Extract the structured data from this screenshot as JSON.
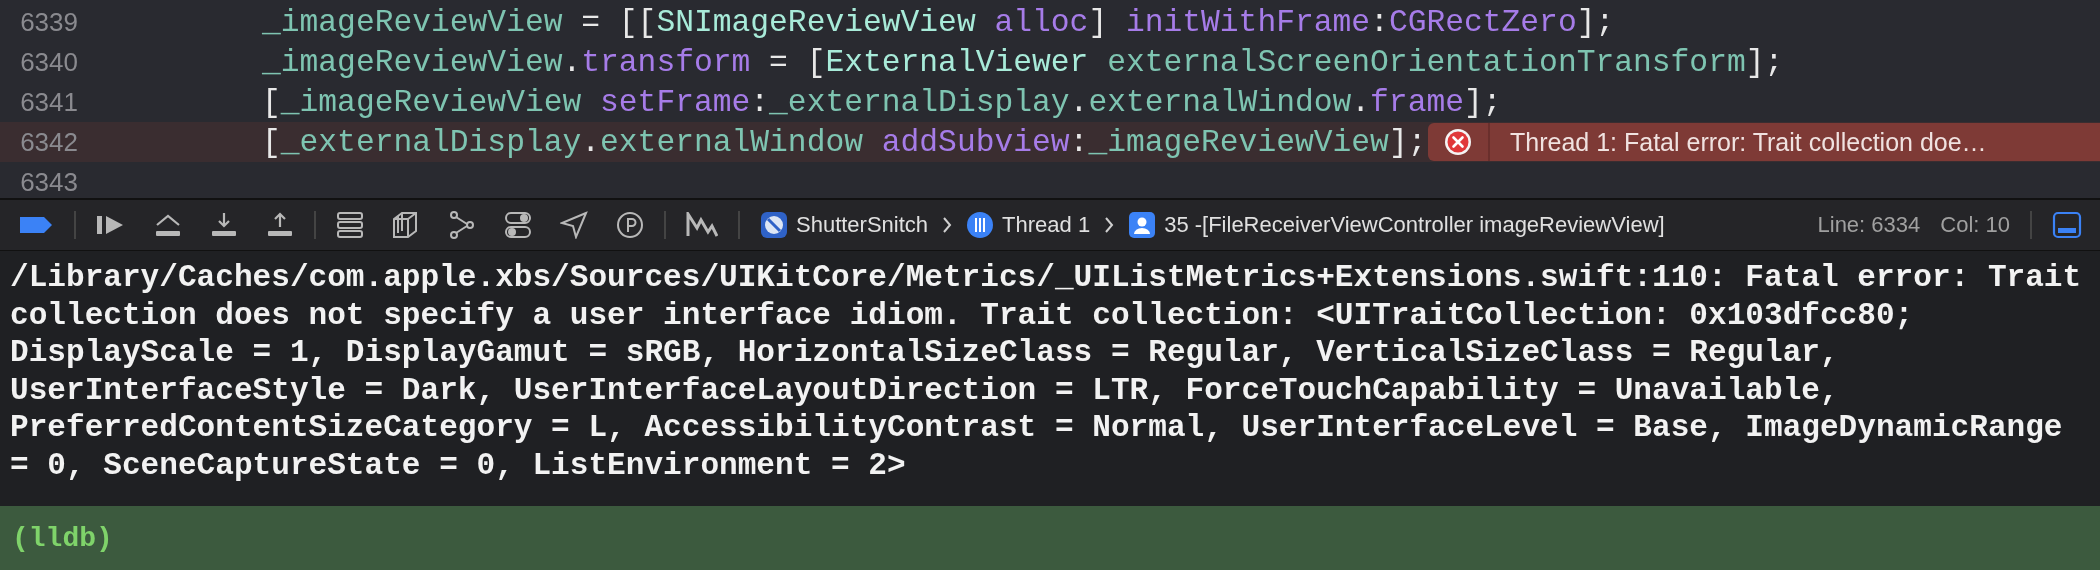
{
  "editor": {
    "lines": [
      {
        "number": "6339",
        "current": false,
        "tokens": [
          {
            "kind": "var",
            "text": "_imageReviewView"
          },
          {
            "kind": "plain",
            "text": " = [["
          },
          {
            "kind": "type",
            "text": "SNImageReviewView "
          },
          {
            "kind": "method",
            "text": "alloc"
          },
          {
            "kind": "plain",
            "text": "] "
          },
          {
            "kind": "method",
            "text": "initWithFrame"
          },
          {
            "kind": "plain",
            "text": ":"
          },
          {
            "kind": "method",
            "text": "CGRectZero"
          },
          {
            "kind": "plain",
            "text": "];"
          }
        ]
      },
      {
        "number": "6340",
        "current": false,
        "tokens": [
          {
            "kind": "var",
            "text": "_imageReviewView"
          },
          {
            "kind": "plain",
            "text": "."
          },
          {
            "kind": "method",
            "text": "transform"
          },
          {
            "kind": "plain",
            "text": " = ["
          },
          {
            "kind": "type",
            "text": "ExternalViewer "
          },
          {
            "kind": "var",
            "text": "externalScreenOrientationTransform"
          },
          {
            "kind": "plain",
            "text": "];"
          }
        ]
      },
      {
        "number": "6341",
        "current": false,
        "tokens": [
          {
            "kind": "plain",
            "text": "["
          },
          {
            "kind": "var",
            "text": "_imageReviewView "
          },
          {
            "kind": "method",
            "text": "setFrame"
          },
          {
            "kind": "plain",
            "text": ":"
          },
          {
            "kind": "var",
            "text": "_externalDisplay"
          },
          {
            "kind": "plain",
            "text": "."
          },
          {
            "kind": "var",
            "text": "externalWindow"
          },
          {
            "kind": "plain",
            "text": "."
          },
          {
            "kind": "method",
            "text": "frame"
          },
          {
            "kind": "plain",
            "text": "];"
          }
        ]
      },
      {
        "number": "6342",
        "current": true,
        "error": "Thread 1: Fatal error: Trait collection doe…",
        "tokens": [
          {
            "kind": "plain",
            "text": "["
          },
          {
            "kind": "var",
            "text": "_externalDisplay"
          },
          {
            "kind": "plain",
            "text": "."
          },
          {
            "kind": "var",
            "text": "externalWindow "
          },
          {
            "kind": "method",
            "text": "addSubview"
          },
          {
            "kind": "plain",
            "text": ":"
          },
          {
            "kind": "var",
            "text": "_imageReviewView"
          },
          {
            "kind": "plain",
            "text": "];"
          }
        ]
      },
      {
        "number": "6343",
        "current": false
      }
    ]
  },
  "debug_bar": {
    "breakpoints_active": true,
    "breadcrumb": [
      {
        "kind": "app",
        "label": "ShutterSnitch"
      },
      {
        "kind": "thread",
        "label": "Thread 1"
      },
      {
        "kind": "frame",
        "label": "35 -[FileReceiverViewController imageReviewView]"
      }
    ],
    "line": "Line: 6334",
    "col": "Col: 10"
  },
  "console": {
    "output": [
      "/Library/Caches/com.apple.xbs/Sources/UIKitCore/Metrics/_UIListMetrics+Extensions.swift:110: Fatal error: Trait",
      "collection does not specify a user interface idiom. Trait collection: <UITraitCollection: 0x103dfcc80;",
      "DisplayScale = 1, DisplayGamut = sRGB, HorizontalSizeClass = Regular, VerticalSizeClass = Regular,",
      "UserInterfaceStyle = Dark, UserInterfaceLayoutDirection = LTR, ForceTouchCapability = Unavailable,",
      "PreferredContentSizeCategory = L, AccessibilityContrast = Normal, UserInterfaceLevel = Base, ImageDynamicRange",
      "= 0, SceneCaptureState = 0, ListEnvironment = 2>"
    ],
    "prompt": "(lldb)"
  }
}
